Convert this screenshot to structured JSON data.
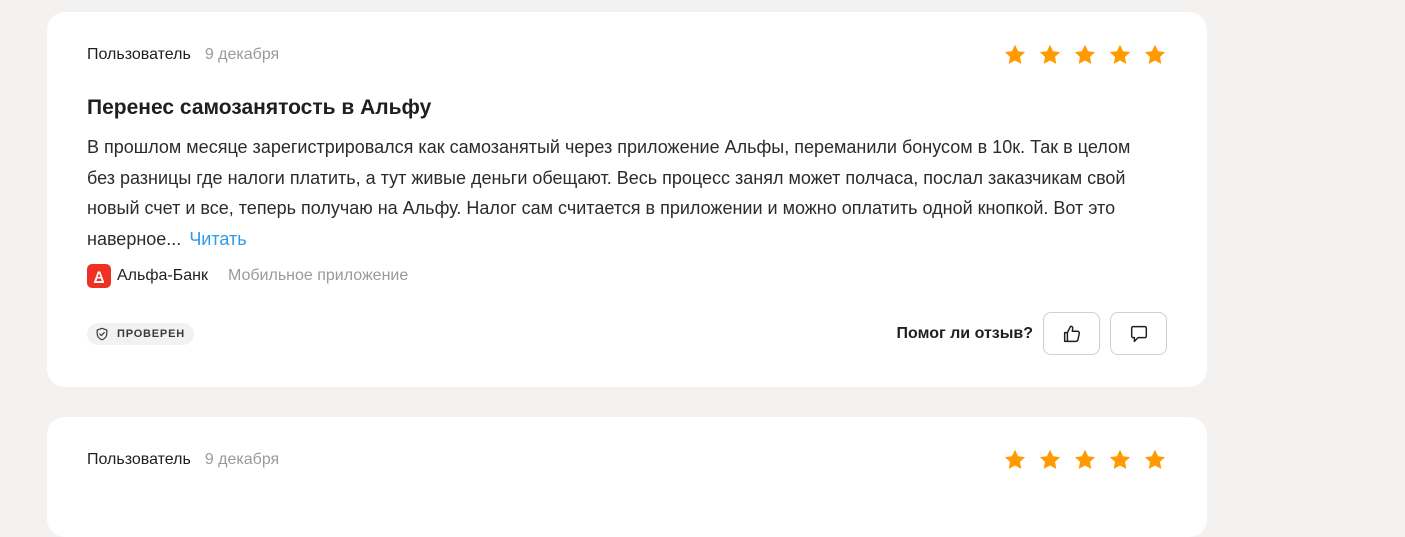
{
  "reviews": [
    {
      "author": "Пользователь",
      "date": "9 декабря",
      "rating": 5,
      "title": "Перенес самозанятость в Альфу",
      "text": "В прошлом месяце зарегистрировался как самозанятый через приложение Альфы, переманили бонусом в 10к. Так в целом без разницы где налоги платить, а тут живые деньги обещают. Весь процесс занял может полчаса, послал заказчикам свой новый счет и все, теперь получаю на Альфу. Налог сам считается в приложении и можно оплатить одной кнопкой. Вот это наверное...",
      "read_more": "Читать",
      "bank": {
        "logo_letter": "А",
        "name": "Альфа-Банк",
        "product": "Мобильное приложение"
      },
      "verified_label": "ПРОВЕРЕН",
      "helpful_label": "Помог ли отзыв?"
    },
    {
      "author": "Пользователь",
      "date": "9 декабря",
      "rating": 5
    }
  ],
  "icons": {
    "star": "star-icon",
    "verified": "shield-check-icon",
    "like": "thumbs-up-icon",
    "comment": "comment-icon"
  },
  "colors": {
    "page_background": "#f3f2f0",
    "card_background": "#ffffff",
    "star": "#ff9a00",
    "link": "#2f9be8",
    "bank_logo": "#ef3124",
    "muted_text": "#9a9a9a"
  }
}
